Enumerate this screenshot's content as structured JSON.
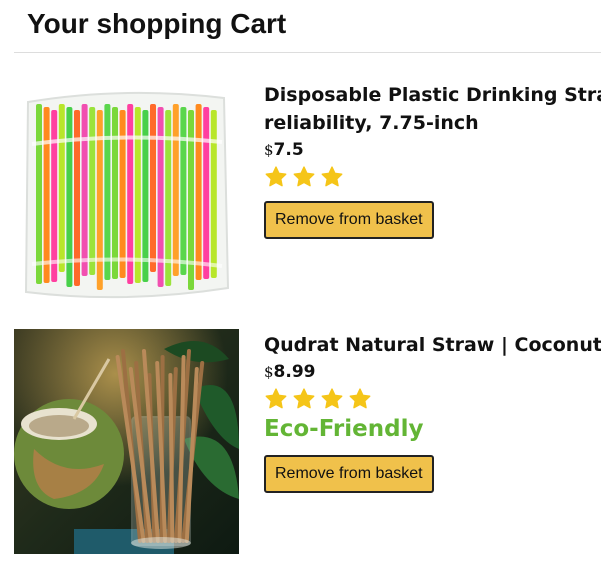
{
  "cart": {
    "title": "Your shopping Cart"
  },
  "products": [
    {
      "title_line1": "Disposable Plastic Drinking Straws",
      "title_line2": "reliability, 7.75-inch",
      "currency_symbol": "$",
      "price": "7.5",
      "rating": 3,
      "tag": "",
      "remove_label": "Remove from basket",
      "image_name": "plastic-straws-image"
    },
    {
      "title_line1": "Qudrat Natural Straw | Coconut",
      "currency_symbol": "$",
      "price": "8.99",
      "rating": 4,
      "tag": "Eco-Friendly",
      "remove_label": "Remove from basket",
      "image_name": "coconut-straws-image"
    }
  ],
  "colors": {
    "button": "#f0c14b",
    "star": "#f5c518",
    "eco_tag": "#63b535"
  },
  "icons": {
    "star": "star-icon"
  }
}
